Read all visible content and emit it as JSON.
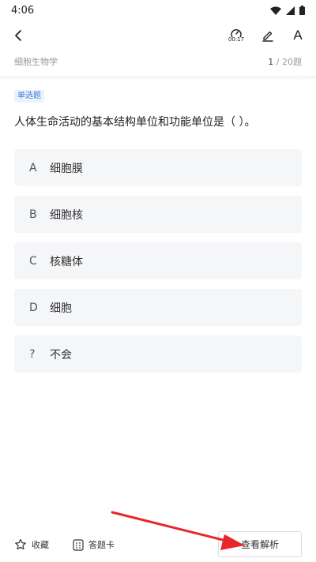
{
  "status_bar": {
    "time": "4:06"
  },
  "top_bar": {
    "timer": "00:17",
    "font_label": "A"
  },
  "subject": {
    "name": "细胞生物学",
    "current": "1",
    "total": " / 20题"
  },
  "question": {
    "type": "单选题",
    "text": "人体生命活动的基本结构单位和功能单位是（ ）。",
    "options": [
      {
        "letter": "A",
        "text": "细胞膜"
      },
      {
        "letter": "B",
        "text": "细胞核"
      },
      {
        "letter": "C",
        "text": "核糖体"
      },
      {
        "letter": "D",
        "text": "细胞"
      },
      {
        "letter": "?",
        "text": "不会"
      }
    ]
  },
  "bottom_bar": {
    "favorite_label": "收藏",
    "answer_card_label": "答题卡",
    "analysis_label": "查看解析"
  },
  "colors": {
    "accent": "#3b7fd9",
    "arrow": "#e8262a",
    "option_bg": "#f5f6f8"
  }
}
